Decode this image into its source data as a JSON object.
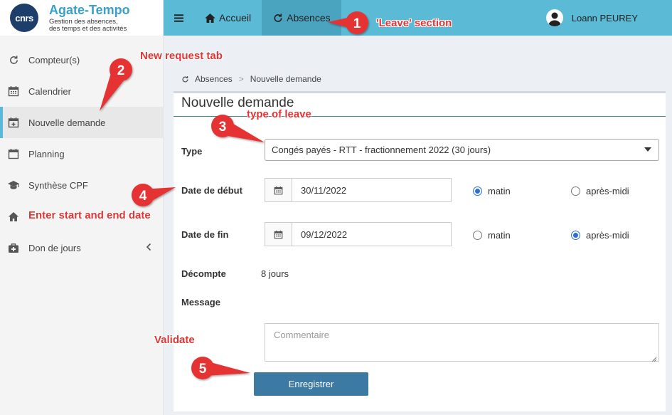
{
  "brand": {
    "logo_text": "cnrs",
    "title": "Agate-Tempo",
    "subtitle_line1": "Gestion des absences,",
    "subtitle_line2": "des temps et des activités"
  },
  "sidebar": {
    "items": [
      {
        "label": "Compteur(s)",
        "icon": "refresh-icon"
      },
      {
        "label": "Calendrier",
        "icon": "calendar-icon"
      },
      {
        "label": "Nouvelle demande",
        "icon": "calendar-plus-icon",
        "active": true
      },
      {
        "label": "Planning",
        "icon": "calendar-icon"
      },
      {
        "label": "Synthèse CPF",
        "icon": "graduation-cap-icon"
      },
      {
        "label": "",
        "icon": "home-icon"
      },
      {
        "label": "Don de jours",
        "icon": "medkit-icon"
      }
    ]
  },
  "topbar": {
    "nav": [
      {
        "label": "Accueil",
        "icon": "home-icon"
      },
      {
        "label": "Absences",
        "icon": "refresh-icon",
        "active": true
      }
    ],
    "user_name": "Loann PEUREY"
  },
  "breadcrumb": {
    "root": "Absences",
    "separator": ">",
    "current": "Nouvelle demande"
  },
  "form": {
    "title": "Nouvelle demande",
    "type_label": "Type",
    "type_value": "Congés payés - RTT - fractionnement 2022 (30 jours)",
    "start_label": "Date de début",
    "start_value": "30/11/2022",
    "end_label": "Date de fin",
    "end_value": "09/12/2022",
    "option_morning": "matin",
    "option_afternoon": "après-midi",
    "start_period": "matin",
    "end_period": "après-midi",
    "count_label": "Décompte",
    "count_value": "8 jours",
    "message_label": "Message",
    "comment_placeholder": "Commentaire",
    "submit_label": "Enregistrer"
  },
  "annotations": [
    {
      "number": "1",
      "text": "'Leave' section"
    },
    {
      "number": "2",
      "text": "New request tab"
    },
    {
      "number": "3",
      "text": "type of leave"
    },
    {
      "number": "4",
      "text": "Enter start and end date"
    },
    {
      "number": "5",
      "text": "Validate"
    }
  ],
  "colors": {
    "topbar": "#5bbad6",
    "brand": "#3a9fc9",
    "button": "#3c7aa3",
    "annotation": "#e53333",
    "active_accent": "#5bb8d9"
  }
}
